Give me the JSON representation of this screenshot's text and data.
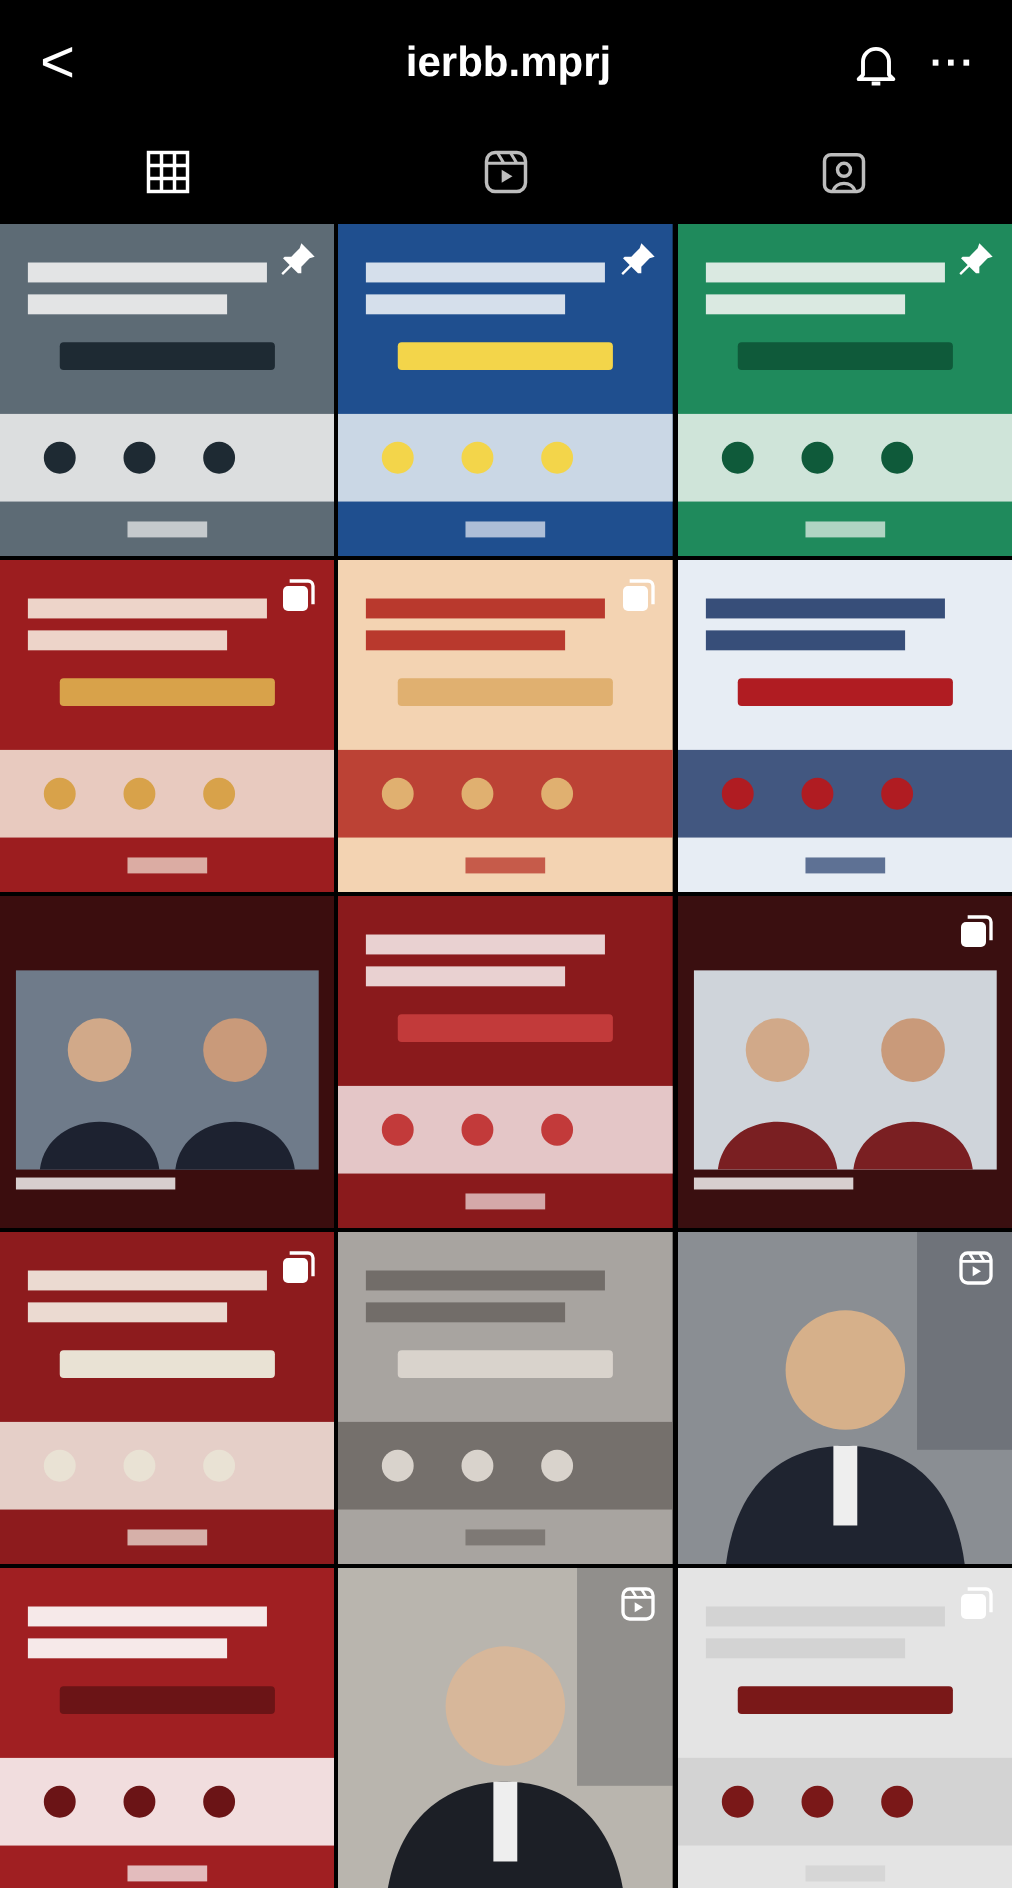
{
  "header": {
    "back": "<",
    "title": "ierbb.mprj",
    "more": "···"
  },
  "tabs": [
    {
      "kind": "grid",
      "selected": true
    },
    {
      "kind": "reels",
      "selected": false
    },
    {
      "kind": "tagged",
      "selected": false
    }
  ],
  "posts": [
    {
      "kind": "pinned"
    },
    {
      "kind": "pinned"
    },
    {
      "kind": "pinned"
    },
    {
      "kind": "carousel"
    },
    {
      "kind": "carousel"
    },
    {
      "kind": "single"
    },
    {
      "kind": "single"
    },
    {
      "kind": "single"
    },
    {
      "kind": "carousel"
    },
    {
      "kind": "carousel"
    },
    {
      "kind": "single"
    },
    {
      "kind": "reel"
    },
    {
      "kind": "single"
    },
    {
      "kind": "reel"
    },
    {
      "kind": "carousel"
    }
  ]
}
